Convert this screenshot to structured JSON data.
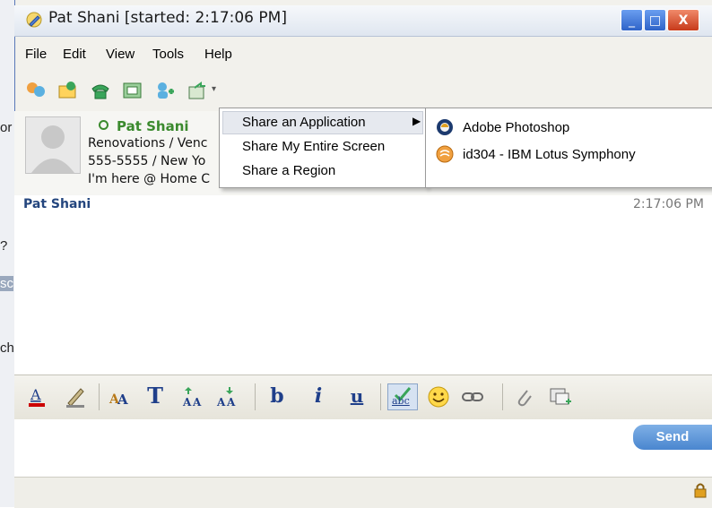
{
  "window": {
    "title": "Pat Shani [started: 2:17:06 PM]",
    "buttons": {
      "minimize": "_",
      "maximize": "□",
      "close": "X"
    }
  },
  "menubar": {
    "items": [
      {
        "label": "File"
      },
      {
        "label": "Edit"
      },
      {
        "label": "View"
      },
      {
        "label": "Tools"
      },
      {
        "label": "Help"
      }
    ]
  },
  "contact": {
    "name": "Pat Shani",
    "line1": "Renovations / Venc",
    "line2": "555-5555 / New Yo",
    "line3": "I'm here @ Home C"
  },
  "transcript": {
    "sender": "Pat Shani",
    "time": "2:17:06 PM"
  },
  "format_toolbar": {
    "text_font": "T",
    "bold": "b",
    "italic": "i",
    "underline": "u",
    "spell": "abc"
  },
  "input": {
    "send_label": "Send"
  },
  "share_menu": {
    "items": [
      {
        "label": "Share an Application",
        "has_submenu": true,
        "highlighted": true
      },
      {
        "label": "Share My Entire Screen"
      },
      {
        "label": "Share a Region"
      }
    ]
  },
  "app_submenu": {
    "items": [
      {
        "label": "Adobe Photoshop",
        "icon": "photoshop-icon"
      },
      {
        "label": "id304 - IBM Lotus Symphony",
        "icon": "symphony-icon"
      }
    ]
  },
  "background_app": {
    "fragments": [
      "or",
      "?",
      "sc",
      "ch"
    ]
  },
  "colors": {
    "title_bar": "#dfe6f0",
    "contact_name": "#3b8a2e",
    "sender_name": "#24467e",
    "send_button": "#4a86cf"
  }
}
